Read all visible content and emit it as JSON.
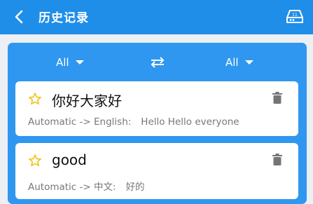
{
  "header": {
    "title": "历史记录",
    "back_icon": "chevron-left-icon",
    "action_icon": "storage-drive-icon"
  },
  "language_bar": {
    "source_lang": "All",
    "target_lang": "All",
    "swap_icon": "swap-arrows-icon"
  },
  "history": [
    {
      "source": "你好大家好",
      "direction": "Automatic -> English:",
      "result": "Hello Hello everyone",
      "favorite_icon": "star-outline-icon",
      "delete_icon": "trash-icon"
    },
    {
      "source": "good",
      "direction": "Automatic -> 中文:",
      "result": "好的",
      "favorite_icon": "star-outline-icon",
      "delete_icon": "trash-icon"
    }
  ],
  "colors": {
    "appbar": "#1f8ee8",
    "panel": "#2f97ef",
    "star": "#f2c31b"
  }
}
